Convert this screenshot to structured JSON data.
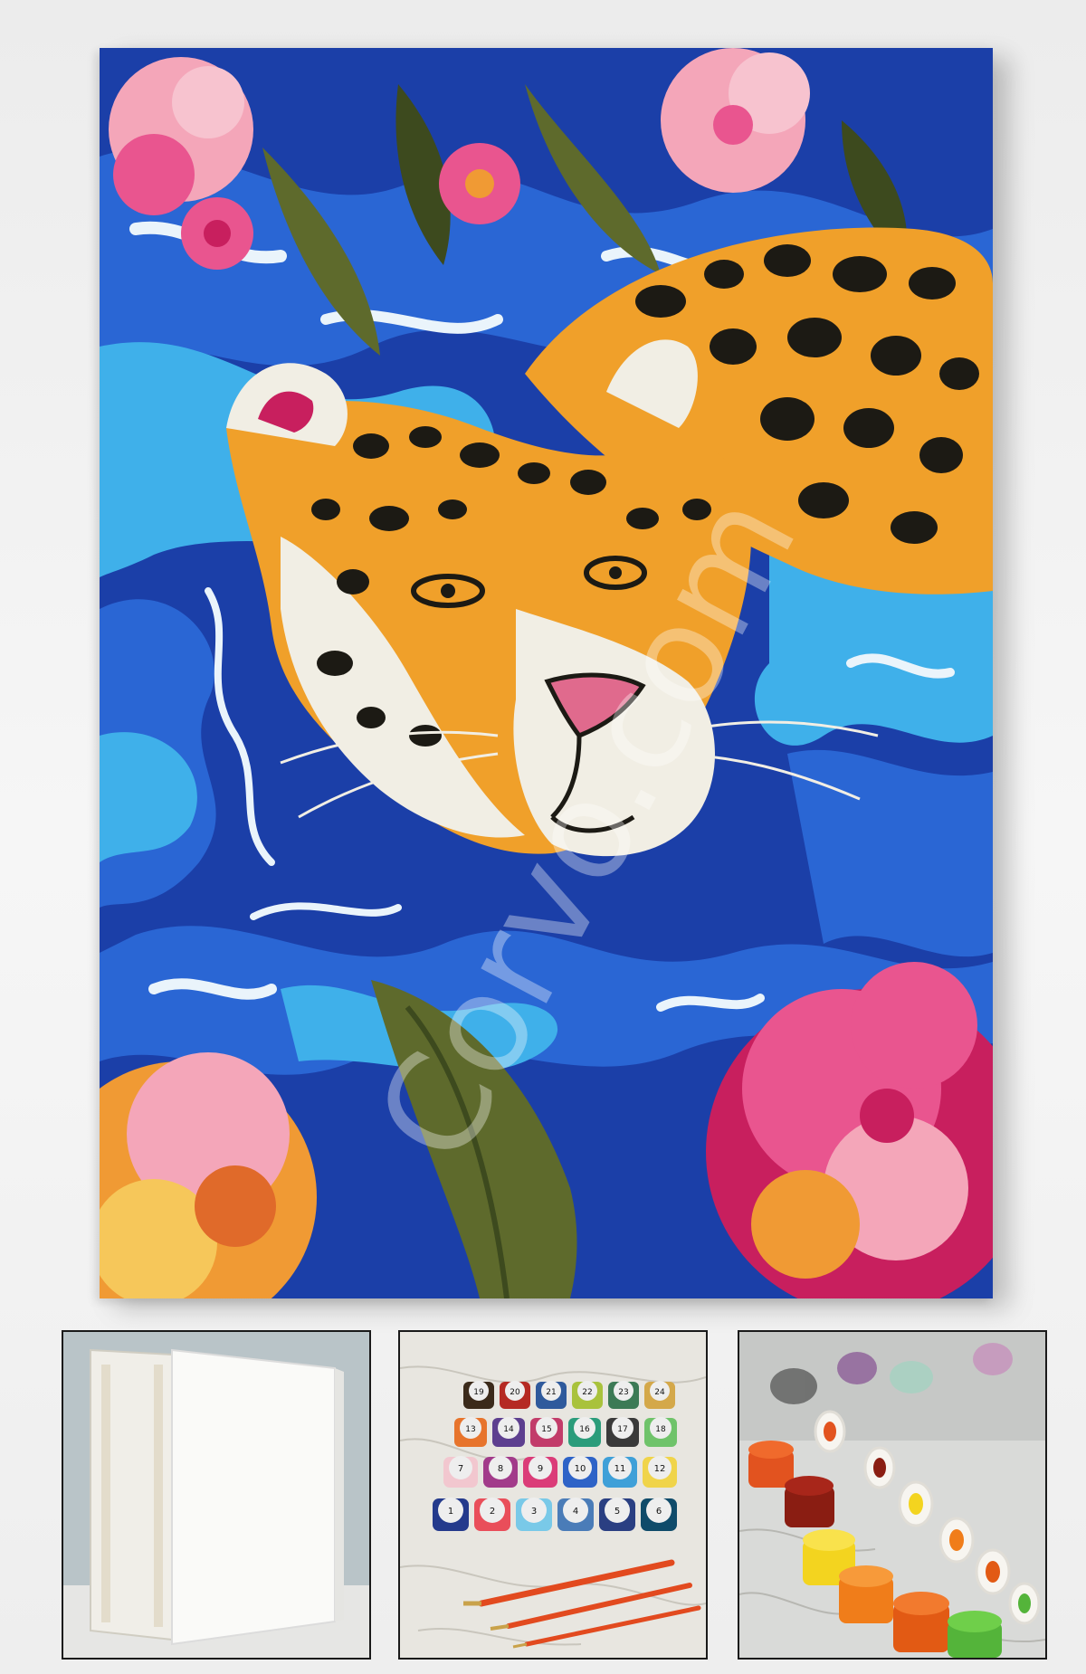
{
  "main_painting": {
    "subject": "jaguar swimming among pink flowers",
    "watermark": "Corvo.com",
    "colors": {
      "water_dark": "#1b3fa8",
      "water_mid": "#2a66d4",
      "water_light": "#3fb0ea",
      "foam": "#eaf4fb",
      "fur_orange": "#f0a02a",
      "fur_light": "#f6c75a",
      "fur_white": "#f1eee4",
      "spots": "#1c1a14",
      "flower_pink": "#e9558f",
      "flower_light": "#f4a6b9",
      "flower_magenta": "#c81f5e",
      "leaf": "#5e6a2c"
    }
  },
  "thumbnails": [
    {
      "label": "blank stretched canvas",
      "icon": "canvas-icon"
    },
    {
      "label": "numbered paint pots and brushes",
      "icon": "paint-pots-icon"
    },
    {
      "label": "open paint pots close-up",
      "icon": "paint-closeup-icon"
    }
  ],
  "paint_pot_numbers": [
    "19",
    "20",
    "21",
    "22",
    "23",
    "24",
    "13",
    "14",
    "15",
    "16",
    "17",
    "18",
    "7",
    "8",
    "9",
    "10",
    "11",
    "12",
    "1",
    "2",
    "3",
    "4",
    "5",
    "6"
  ]
}
